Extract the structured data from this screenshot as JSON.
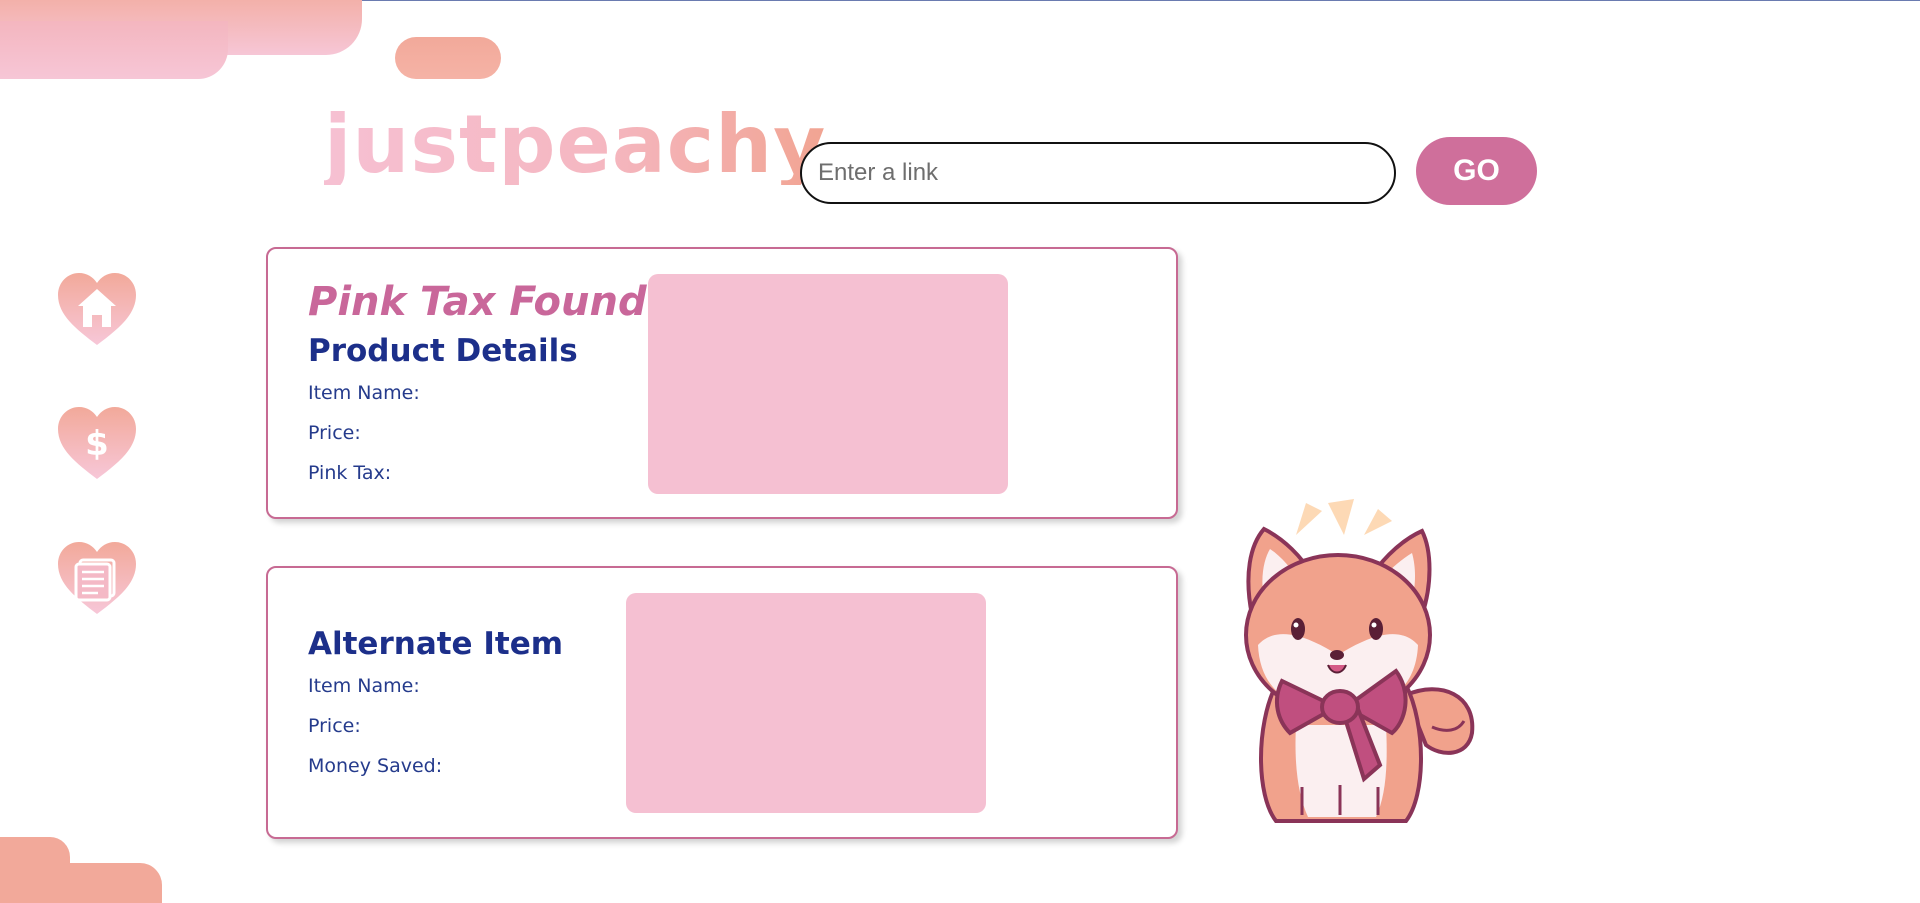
{
  "app": {
    "logo_text": "justpeachy",
    "accent_color": "#cf6f9b",
    "peach_color": "#f2a99a",
    "pink_color": "#f5c0d2",
    "navy_color": "#1c2f8a"
  },
  "search": {
    "placeholder": "Enter a link",
    "value": "",
    "button_label": "GO"
  },
  "sidebar": {
    "items": [
      {
        "icon": "home-icon"
      },
      {
        "icon": "dollar-icon"
      },
      {
        "icon": "document-icon"
      }
    ]
  },
  "product_card": {
    "alert": "Pink Tax Found!",
    "heading": "Product Details",
    "fields": [
      "Item Name:",
      "Price:",
      "Pink Tax:"
    ]
  },
  "alternate_card": {
    "heading": "Alternate Item",
    "fields": [
      "Item Name:",
      "Price:",
      "Money Saved:"
    ]
  },
  "mascot": {
    "icon": "shiba-dog-with-bow"
  }
}
